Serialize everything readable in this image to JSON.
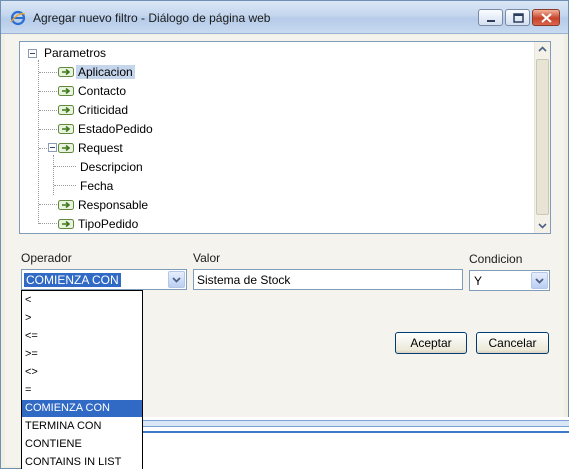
{
  "window": {
    "title": "Agregar nuevo filtro - Diálogo de página web",
    "icon": "ie-icon"
  },
  "tree": {
    "root": "Parametros",
    "items": [
      {
        "label": "Aplicacion",
        "selected": true
      },
      {
        "label": "Contacto"
      },
      {
        "label": "Criticidad"
      },
      {
        "label": "EstadoPedido"
      },
      {
        "label": "Request"
      },
      {
        "label": "Descripcion"
      },
      {
        "label": "Fecha"
      },
      {
        "label": "Responsable"
      },
      {
        "label": "TipoPedido"
      }
    ]
  },
  "form": {
    "operador_label": "Operador",
    "valor_label": "Valor",
    "condicion_label": "Condicion",
    "operador_value": "COMIENZA CON",
    "valor_value": "Sistema de Stock",
    "condicion_value": "Y"
  },
  "buttons": {
    "accept": "Aceptar",
    "cancel": "Cancelar"
  },
  "operador_options": [
    "<",
    ">",
    "<=",
    ">=",
    "<>",
    "=",
    "COMIENZA CON",
    "TERMINA CON",
    "CONTIENE",
    "CONTAINS IN LIST"
  ],
  "colors": {
    "selection": "#316ac5",
    "border": "#7f9db9"
  }
}
